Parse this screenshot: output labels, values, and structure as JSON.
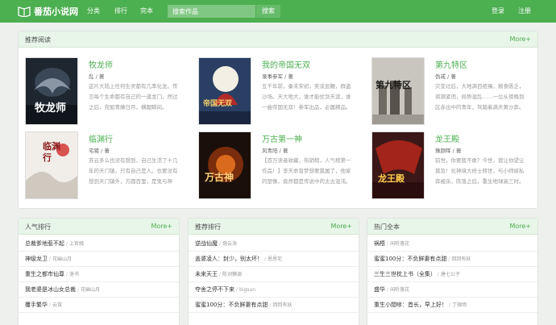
{
  "header": {
    "logo_text": "番茄小说网",
    "nav": [
      "分类",
      "排行",
      "完本"
    ],
    "search_placeholder": "搜索作品",
    "search_button": "搜索",
    "login": "登录",
    "register": "注册"
  },
  "recommend": {
    "title": "推荐阅读",
    "more": "More+",
    "books": [
      {
        "title": "牧龙师",
        "author": "乱 / 著",
        "desc": "这片大陆上任何生灵都有几率化龙。传言每个生命都有自己的一道龙门，然过之后，宛如青藤日月，横踞瞬间。",
        "cover_text": "牧龙师"
      },
      {
        "title": "我的帝国无双",
        "author": "录事参军 / 著",
        "desc": "五千年前，秦末宋初，奕谈显鞭，群盗沙场。天大地大，谁才能仗剑天涯，谁一曲帝国无双！参军出品，必属精品。",
        "cover_text": "帝国无双"
      },
      {
        "title": "第九特区",
        "author": "伪戒 / 著",
        "desc": "灾变过后，大地满目疮痍，粮食匮乏，资源紧俏，局势混乱……一位从傍晚到区赤出中的青年，驾踏着满天黄沙奔。",
        "cover_text": "第九特区"
      },
      {
        "title": "临渊行",
        "author": "宅猪 / 著",
        "desc": "苏云多么也没有想到，自己生活了十几年的天门镇，只有自己是人。也要没有想到天门镇外，方圆百里，是鬼与神灵。",
        "cover_text": "临渊行"
      },
      {
        "title": "万古第一神",
        "author": "风青阳 / 著",
        "desc": "【百万读者收藏，热销榜，人气榜第一作品！】李天命曾梦想要莫属了，他家的塑像，竟然都是传说中的太古混沌。",
        "cover_text": "万古神"
      },
      {
        "title": "龙王殿",
        "author": "豫颜晖 / 著",
        "desc": "前世，你要我不敢？今世，我让你望尘莫及！化神境大修士转世，与小师妹私奔被杀，陈落之后，重生地球高三时。",
        "cover_text": "龙王殿"
      }
    ]
  },
  "lists": [
    {
      "title": "人气排行",
      "more": "More+",
      "items": [
        {
          "title": "总裁爹地惹不起",
          "author": "上官嫣"
        },
        {
          "title": "神级龙卫",
          "author": "花幽山月"
        },
        {
          "title": "重生之都市仙尊",
          "author": "洛书"
        },
        {
          "title": "我老婆是冰山女总裁",
          "author": "花幽山月"
        },
        {
          "title": "覆手繁华",
          "author": "云霓"
        }
      ]
    },
    {
      "title": "推荐排行",
      "more": "More+",
      "items": [
        {
          "title": "逆战仙魔",
          "author": "熔云海"
        },
        {
          "title": "盖婆凌人：封少，别太坏！",
          "author": "恩恩宅"
        },
        {
          "title": "未来天王",
          "author": "陈词懒调"
        },
        {
          "title": "夺舍之停不下来",
          "author": "bigsun"
        },
        {
          "title": "蜜蜜100分：不负鲜妻有点甜",
          "author": "回回有妖"
        }
      ]
    },
    {
      "title": "热门全本",
      "more": "More+",
      "items": [
        {
          "title": "祸梧",
          "author": "闲听落花"
        },
        {
          "title": "蜜蜜100分：不负鲜妻有点甜",
          "author": "回回有妖"
        },
        {
          "title": "三生三世枕上书（全集）",
          "author": "唐七公子"
        },
        {
          "title": "盛华",
          "author": "闲听落花"
        },
        {
          "title": "重生小閤嗲：首长，早上好！",
          "author": "丁微明"
        }
      ]
    }
  ]
}
